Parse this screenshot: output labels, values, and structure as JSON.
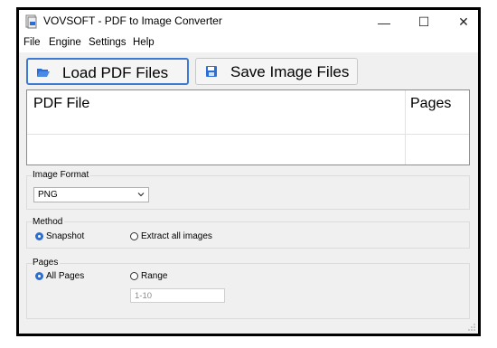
{
  "window": {
    "title": "VOVSOFT - PDF to Image Converter",
    "controls": {
      "minimize": "—",
      "maximize": "☐",
      "close": "✕"
    }
  },
  "menu": [
    "File",
    "Engine",
    "Settings",
    "Help"
  ],
  "toolbar": {
    "load_label": "Load PDF Files",
    "save_label": "Save Image Files"
  },
  "table": {
    "columns": [
      "PDF File",
      "Pages"
    ],
    "rows": []
  },
  "image_format": {
    "label": "Image Format",
    "selected": "PNG"
  },
  "method": {
    "label": "Method",
    "options": [
      "Snapshot",
      "Extract all images"
    ],
    "selected": "Snapshot"
  },
  "pages": {
    "label": "Pages",
    "options": [
      "All Pages",
      "Range"
    ],
    "selected": "All Pages",
    "range_placeholder": "1-10"
  },
  "colors": {
    "accent": "#2b6fd6",
    "window_bg": "#f0f0f0"
  }
}
